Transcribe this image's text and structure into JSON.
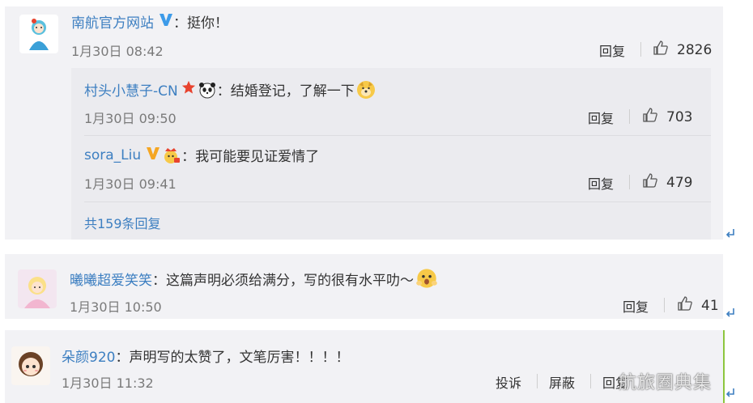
{
  "comments": [
    {
      "author": "南航官方网站",
      "colon": "：",
      "text": "挺你！",
      "time": "1月30日 08:42",
      "reply_label": "回复",
      "likes": "2826",
      "replies": [
        {
          "author": "村头小慧子-CN",
          "colon": "：",
          "text": "结婚登记，了解一下",
          "time": "1月30日 09:50",
          "reply_label": "回复",
          "likes": "703"
        },
        {
          "author": "sora_Liu",
          "colon": "：",
          "text": "我可能要见证爱情了",
          "time": "1月30日 09:41",
          "reply_label": "回复",
          "likes": "479"
        }
      ],
      "more_replies": "共159条回复"
    },
    {
      "author": "曦曦超爱笑笑",
      "colon": "：",
      "text": "这篇声明必须给满分，写的很有水平叻～",
      "time": "1月30日 10:50",
      "reply_label": "回复",
      "likes": "41"
    },
    {
      "author": "朵颜920",
      "colon": "：",
      "text": "声明写的太赞了，文笔厉害！！！！",
      "time": "1月30日 11:32",
      "report_label": "投诉",
      "block_label": "屏蔽",
      "reply_label": "回复"
    }
  ],
  "watermark": "航旅圈典集",
  "colors": {
    "link": "#3d7fc1",
    "verified": "#f5a623",
    "accent_bar": "#8dc63f",
    "star": "#e8432e"
  },
  "icons": [
    "verified-v-icon",
    "star-icon",
    "panda-icon",
    "doge-icon",
    "crown-icon",
    "shocked-icon",
    "thumb-up-icon",
    "reply-arrow-icon"
  ]
}
